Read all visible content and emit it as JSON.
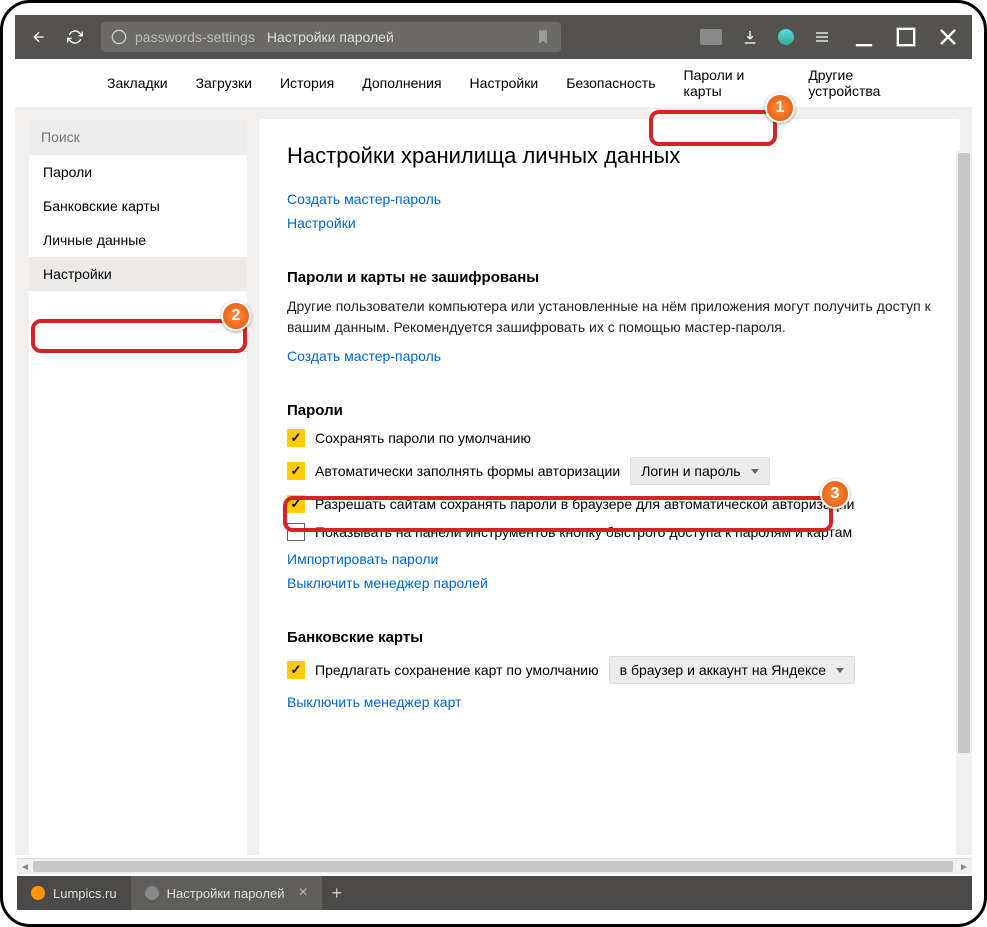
{
  "titlebar": {
    "url": "passwords-settings",
    "page_title": "Настройки паролей"
  },
  "topnav": {
    "items": [
      "Закладки",
      "Загрузки",
      "История",
      "Дополнения",
      "Настройки",
      "Безопасность",
      "Пароли и карты",
      "Другие устройства"
    ]
  },
  "sidebar": {
    "search_placeholder": "Поиск",
    "items": [
      "Пароли",
      "Банковские карты",
      "Личные данные",
      "Настройки"
    ]
  },
  "main": {
    "heading": "Настройки хранилища личных данных",
    "create_master": "Создать мастер-пароль",
    "settings_link": "Настройки",
    "encrypt_title": "Пароли и карты не зашифрованы",
    "encrypt_desc": "Другие пользователи компьютера или установленные на нём приложения могут получить доступ к вашим данным. Рекомендуется зашифровать их с помощью мастер-пароля.",
    "create_master2": "Создать мастер-пароль",
    "passwords_title": "Пароли",
    "cb_save": "Сохранять пароли по умолчанию",
    "cb_autofill": "Автоматически заполнять формы авторизации",
    "dd_autofill": "Логин и пароль",
    "cb_allow_sites": "Разрешать сайтам сохранять пароли в браузере для автоматической авторизации",
    "cb_toolbar": "Показывать на панели инструментов кнопку быстрого доступа к паролям и картам",
    "import_link": "Импортировать пароли",
    "disable_pwmgr": "Выключить менеджер паролей",
    "cards_title": "Банковские карты",
    "cb_save_cards": "Предлагать сохранение карт по умолчанию",
    "dd_cards": "в браузер и аккаунт на Яндексе",
    "disable_cardmgr": "Выключить менеджер карт"
  },
  "tabs": {
    "tab1": "Lumpics.ru",
    "tab2": "Настройки паролей"
  },
  "badges": {
    "b1": "1",
    "b2": "2",
    "b3": "3"
  }
}
